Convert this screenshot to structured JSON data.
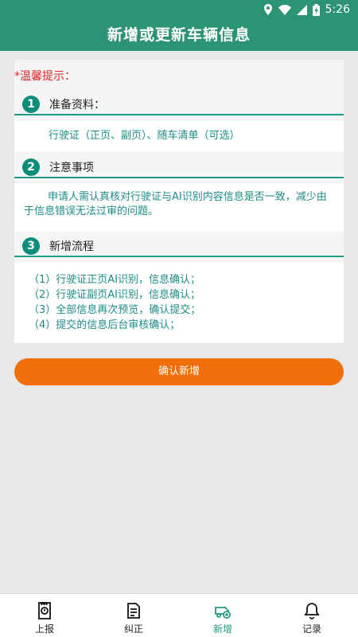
{
  "status_bar": {
    "time": "5:26"
  },
  "header": {
    "title": "新增或更新车辆信息"
  },
  "tip": {
    "label": "*温馨提示："
  },
  "sections": [
    {
      "number": "1",
      "title": "准备资料：",
      "body": "行驶证（正页、副页）、随车清单（可选）"
    },
    {
      "number": "2",
      "title": "注意事项",
      "body": "申请人需认真核对行驶证与AI识别内容信息是否一致，减少由于信息错误无法过审的问题。"
    },
    {
      "number": "3",
      "title": "新增流程",
      "steps": [
        "（1）行驶证正页AI识别，信息确认；",
        "（2）行驶证副页AI识别，信息确认；",
        "（3）全部信息再次预览，确认提交；",
        "（4）提交的信息后台审核确认；"
      ]
    }
  ],
  "confirm_button": {
    "label": "确认新增"
  },
  "tabs": [
    {
      "label": "上报",
      "icon": "report-icon",
      "active": false
    },
    {
      "label": "纠正",
      "icon": "correct-icon",
      "active": false
    },
    {
      "label": "新增",
      "icon": "add-vehicle-icon",
      "active": true
    },
    {
      "label": "记录",
      "icon": "bell-icon",
      "active": false
    }
  ],
  "colors": {
    "primary": "#2c9474",
    "accent": "#f16f0a",
    "tip_red": "#e0262c",
    "body_text": "#1e8c86"
  }
}
